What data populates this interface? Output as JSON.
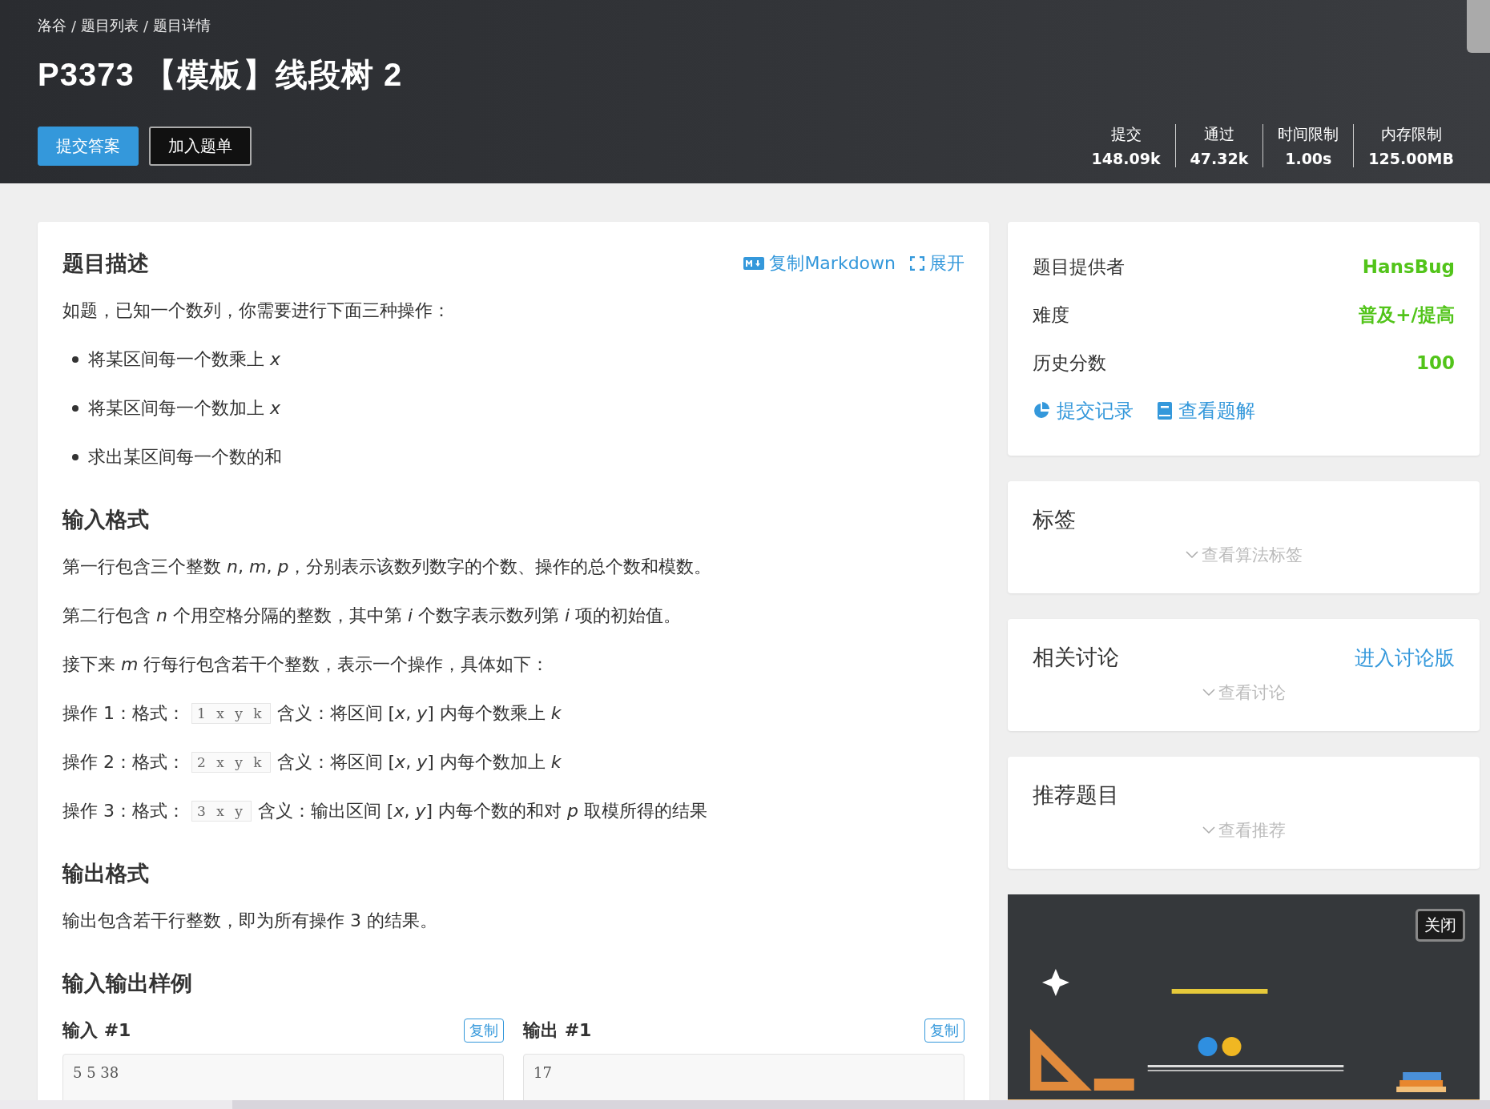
{
  "breadcrumb": {
    "separator": "/",
    "items": [
      "洛谷",
      "题目列表",
      "题目详情"
    ]
  },
  "title": "P3373 【模板】线段树 2",
  "actions": [
    {
      "label": "提交答案",
      "kind": "primary"
    },
    {
      "label": "加入题单",
      "kind": "outline"
    }
  ],
  "stats": [
    {
      "label": "提交",
      "value": "148.09k"
    },
    {
      "label": "通过",
      "value": "47.32k"
    },
    {
      "label": "时间限制",
      "value": "1.00s"
    },
    {
      "label": "内存限制",
      "value": "125.00MB"
    }
  ],
  "problem": {
    "heading": "题目描述",
    "tools": [
      {
        "kind": "markdown",
        "label": "复制Markdown"
      },
      {
        "kind": "expand",
        "label": "展开"
      }
    ],
    "sections": [
      {
        "kind": "text",
        "text": "如题，已知一个数列，你需要进行下面三种操作："
      },
      {
        "kind": "list",
        "items": [
          "将某区间每一个数乘上 *x*",
          "将某区间每一个数加上 *x*",
          "求出某区间每一个数的和"
        ]
      },
      {
        "kind": "heading",
        "text": "输入格式"
      },
      {
        "kind": "text",
        "text": "第一行包含三个整数 *n*, *m*, *p*，分别表示该数列数字的个数、操作的总个数和模数。"
      },
      {
        "kind": "text",
        "text": "第二行包含 *n* 个用空格分隔的整数，其中第 *i* 个数字表示数列第 *i* 项的初始值。"
      },
      {
        "kind": "text",
        "text": "接下来 *m* 行每行包含若干个整数，表示一个操作，具体如下："
      },
      {
        "kind": "op",
        "before": "操作 1：格式：",
        "code": "1 x y k",
        "after": "含义：将区间 [*x*, *y*] 内每个数乘上 *k*"
      },
      {
        "kind": "op",
        "before": "操作 2：格式：",
        "code": "2 x y k",
        "after": "含义：将区间 [*x*, *y*] 内每个数加上 *k*"
      },
      {
        "kind": "op",
        "before": "操作 3：格式：",
        "code": "3 x y",
        "after": "含义：输出区间 [*x*, *y*] 内每个数的和对 *p* 取模所得的结果"
      },
      {
        "kind": "heading",
        "text": "输出格式"
      },
      {
        "kind": "text",
        "text": "输出包含若干行整数，即为所有操作 3 的结果。"
      },
      {
        "kind": "heading",
        "text": "输入输出样例"
      }
    ],
    "samples": [
      {
        "label": "输入 #1",
        "copy": "复制",
        "content": "5 5 38"
      },
      {
        "label": "输出 #1",
        "copy": "复制",
        "content": "17"
      }
    ]
  },
  "info": {
    "rows": [
      {
        "label": "题目提供者",
        "value": "HansBug"
      },
      {
        "label": "难度",
        "value": "普及+/提高"
      },
      {
        "label": "历史分数",
        "value": "100"
      }
    ],
    "links": [
      {
        "kind": "records",
        "label": "提交记录"
      },
      {
        "kind": "solutions",
        "label": "查看题解"
      }
    ]
  },
  "panels": [
    {
      "title": "标签",
      "toggle": "查看算法标签"
    },
    {
      "title": "相关讨论",
      "link": "进入讨论版",
      "toggle": "查看讨论"
    },
    {
      "title": "推荐题目",
      "toggle": "查看推荐"
    }
  ],
  "ad": {
    "kind": "picture",
    "close": "关闭"
  }
}
